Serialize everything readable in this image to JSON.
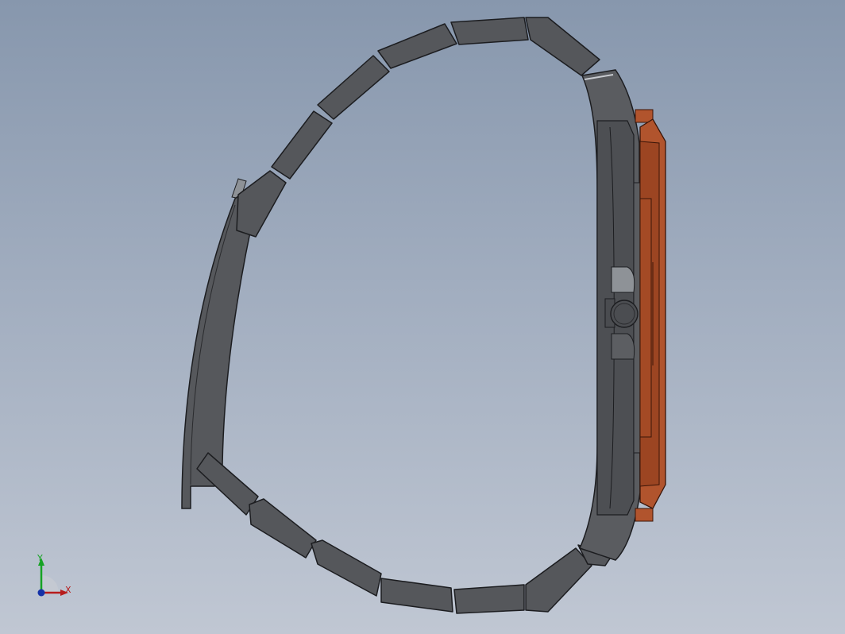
{
  "colors": {
    "background_top": "#8797ad",
    "background_bottom": "#c0c7d3",
    "band_fill": "#55575b",
    "band_edge": "#1c1d20",
    "case_fill": "#5c5e62",
    "bezel_fill": "#b1542d",
    "bezel_dark": "#7a3219",
    "crown_fill": "#4d4f53",
    "x_axis": "#b71c1c",
    "y_axis": "#16a324",
    "z_axis": "#1532a8"
  },
  "model": {
    "part": "watch",
    "view": "side",
    "components": [
      "bracelet-links",
      "case",
      "bezel",
      "crown",
      "clasp"
    ]
  },
  "triad": {
    "x_label": "X",
    "y_label": "Y"
  }
}
